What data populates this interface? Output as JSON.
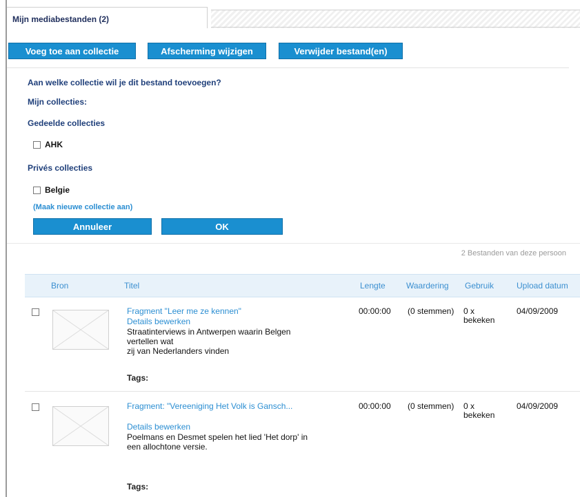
{
  "tab": {
    "title": "Mijn mediabestanden (2)"
  },
  "toolbar": {
    "add_to_collection": "Voeg toe aan collectie",
    "change_shielding": "Afscherming wijzigen",
    "delete_files": "Verwijder bestand(en)"
  },
  "collection_panel": {
    "question": "Aan welke collectie wil je dit bestand toevoegen?",
    "my_collections": "Mijn collecties:",
    "shared_heading": "Gedeelde collecties",
    "shared_items": [
      "AHK"
    ],
    "private_heading": "Privés collecties",
    "private_items": [
      "Belgie"
    ],
    "new_collection_link": "(Maak nieuwe collectie aan)",
    "cancel_label": "Annuleer",
    "ok_label": "OK"
  },
  "file_count": "2  Bestanden van deze persoon",
  "table": {
    "headers": {
      "source": "Bron",
      "title": "Titel",
      "length": "Lengte",
      "rating": "Waardering",
      "usage": "Gebruik",
      "upload": "Upload datum"
    },
    "rows": [
      {
        "title": "Fragment \"Leer me ze kennen\"",
        "edit": "Details bewerken",
        "desc_lines": [
          "Straatinterviews in Antwerpen waarin Belgen",
          "vertellen wat",
          "zij van Nederlanders vinden"
        ],
        "length": "00:00:00",
        "rating": "(0 stemmen)",
        "usage": "0 x",
        "usage2": "bekeken",
        "upload": "04/09/2009",
        "tags": "Tags:"
      },
      {
        "title": "Fragment: \"Vereeniging Het Volk is Gansch...",
        "edit": "Details bewerken",
        "desc_lines": [
          "Poelmans en Desmet spelen het lied 'Het dorp' in",
          "een allochtone versie."
        ],
        "length": "00:00:00",
        "rating": "(0 stemmen)",
        "usage": "0 x",
        "usage2": "bekeken",
        "upload": "04/09/2009",
        "tags": "Tags:"
      }
    ]
  }
}
